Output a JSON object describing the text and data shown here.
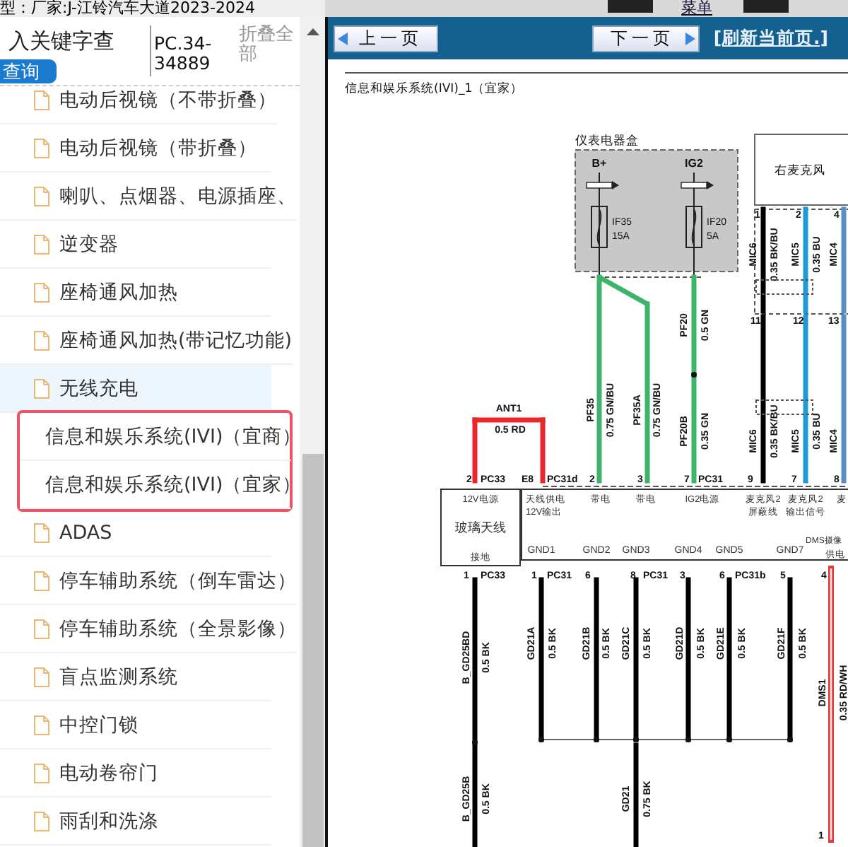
{
  "header": {
    "text": "型：厂家:J-江铃汽车大道2023-2024",
    "menu_link": "菜单"
  },
  "sidebar": {
    "search": {
      "value": "入关键字查"
    },
    "search_button": "查询",
    "page_code": "PC.34-34889",
    "collapse_link": "折叠全部",
    "items": [
      {
        "label": "电动后视镜（不带折叠）",
        "selected": false,
        "highlighted": false
      },
      {
        "label": "电动后视镜（带折叠）",
        "selected": false,
        "highlighted": false
      },
      {
        "label": "喇叭、点烟器、电源插座、",
        "selected": false,
        "highlighted": false
      },
      {
        "label": "逆变器",
        "selected": false,
        "highlighted": false
      },
      {
        "label": "座椅通风加热",
        "selected": false,
        "highlighted": false
      },
      {
        "label": "座椅通风加热(带记忆功能)",
        "selected": false,
        "highlighted": false
      },
      {
        "label": "无线充电",
        "selected": true,
        "highlighted": false
      },
      {
        "label": "信息和娱乐系统(IVI)（宜商）",
        "selected": false,
        "highlighted": true
      },
      {
        "label": "信息和娱乐系统(IVI)（宜家）",
        "selected": false,
        "highlighted": true
      },
      {
        "label": "ADAS",
        "selected": false,
        "highlighted": false
      },
      {
        "label": "停车辅助系统（倒车雷达）",
        "selected": false,
        "highlighted": false
      },
      {
        "label": "停车辅助系统（全景影像）",
        "selected": false,
        "highlighted": false
      },
      {
        "label": "盲点监测系统",
        "selected": false,
        "highlighted": false
      },
      {
        "label": "中控门锁",
        "selected": false,
        "highlighted": false
      },
      {
        "label": "电动卷帘门",
        "selected": false,
        "highlighted": false
      },
      {
        "label": "雨刮和洗涤",
        "selected": false,
        "highlighted": false
      }
    ]
  },
  "viewer": {
    "prev_button": "上一页",
    "next_button": "下一页",
    "refresh_link": "[刷新当前页.]",
    "title": "信息和娱乐系统(IVI)_1（宜家）",
    "diagram": {
      "fuse_box": {
        "label": "仪表电器盒",
        "terminals": [
          "B+",
          "IG2"
        ],
        "fuses": [
          {
            "name": "IF35",
            "rating": "15A"
          },
          {
            "name": "IF20",
            "rating": "5A"
          }
        ]
      },
      "microphone": "右麦克风",
      "wires": [
        {
          "name": "PF35",
          "spec": "0.75 GN/BU",
          "color": "#3cb46a"
        },
        {
          "name": "PF35A",
          "spec": "0.75 GN/BU",
          "color": "#3cb46a"
        },
        {
          "name": "PF20",
          "spec": "0.5 GN",
          "color": "#3cb46a"
        },
        {
          "name": "PF20B",
          "spec": "0.35 GN",
          "color": "#3cb46a"
        },
        {
          "name": "MIC6",
          "spec": "0.35 BK/BU",
          "color": "#000000"
        },
        {
          "name": "MIC5",
          "spec": "0.35 BU",
          "color": "#1e9ad6"
        },
        {
          "name": "MIC4",
          "color": "#5b8fc4"
        },
        {
          "name": "MIC6",
          "spec": "0.35 BK/BU",
          "color": "#000000"
        },
        {
          "name": "MIC5",
          "spec": "0.35 BU",
          "color": "#1e9ad6"
        },
        {
          "name": "MIC4",
          "color": "#5b8fc4"
        },
        {
          "name": "ANT1",
          "spec": "0.5 RD",
          "color": "#e8282a"
        },
        {
          "name": "B_GD25BD",
          "spec": "0.5 BK",
          "color": "#000000"
        },
        {
          "name": "GD21A",
          "spec": "0.5 BK",
          "color": "#000000"
        },
        {
          "name": "GD21B",
          "spec": "0.5 BK",
          "color": "#000000"
        },
        {
          "name": "GD21C",
          "spec": "0.5 BK",
          "color": "#000000"
        },
        {
          "name": "GD21D",
          "spec": "0.5 BK",
          "color": "#000000"
        },
        {
          "name": "GD21E",
          "spec": "0.5 BK",
          "color": "#000000"
        },
        {
          "name": "GD21F",
          "spec": "0.5 BK",
          "color": "#000000"
        },
        {
          "name": "B_GD25B",
          "spec": "0.5 BK",
          "color": "#000000"
        },
        {
          "name": "GD21",
          "spec": "0.75 BK",
          "color": "#000000"
        },
        {
          "name": "DMS1",
          "spec": "0.35 RD/WH",
          "color": "#e03a3a"
        }
      ],
      "pins": [
        "1",
        "2",
        "4",
        "11",
        "12",
        "13",
        "2",
        "PC33",
        "E8",
        "PC31d",
        "2",
        "3",
        "7",
        "PC31",
        "9",
        "7",
        "8",
        "1",
        "PC33",
        "1",
        "PC31",
        "6",
        "8",
        "PC31",
        "3",
        "6",
        "PC31b",
        "5",
        "4",
        "1"
      ],
      "component_labels": [
        "12V电源",
        "玻璃天线",
        "接地",
        "天线供电",
        "12V输出",
        "带电",
        "带电",
        "IG2电源",
        "麦克风2",
        "屏蔽线",
        "麦克风2",
        "输出信号",
        "麦",
        "GND1",
        "GND2",
        "GND3",
        "GND4",
        "GND5",
        "GND7",
        "DMS摄像",
        "供电"
      ]
    }
  }
}
